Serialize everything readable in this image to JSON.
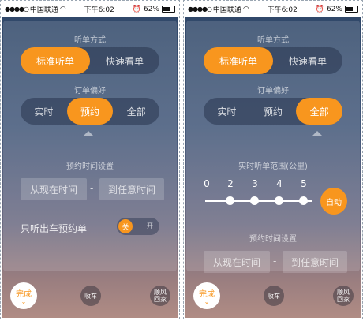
{
  "status_bar": {
    "carrier": "中国联通",
    "time": "下午6:02",
    "battery": "62%"
  },
  "labels": {
    "listen_mode": "听单方式",
    "order_pref": "订单偏好",
    "reserve_time_setting": "预约时间设置",
    "range_setting": "实时听单范围(公里)",
    "only_reserve": "只听出车预约单"
  },
  "listen_mode_options": [
    "标准听单",
    "快速看单"
  ],
  "order_pref_options": [
    "实时",
    "预约",
    "全部"
  ],
  "time": {
    "from": "从现在时间",
    "dash": "-",
    "to": "到任意时间"
  },
  "toggle": {
    "on": "关",
    "off": "开"
  },
  "range_scale": [
    "0",
    "2",
    "3",
    "4",
    "5"
  ],
  "range_auto": "自动",
  "bottom": {
    "done": "完成",
    "stop": "收车",
    "ride_home_line1": "顺风",
    "ride_home_line2": "回家"
  },
  "colors": {
    "accent": "#f8961e"
  },
  "screens": {
    "left": {
      "order_pref_selected": "预约"
    },
    "right": {
      "order_pref_selected": "全部"
    }
  }
}
